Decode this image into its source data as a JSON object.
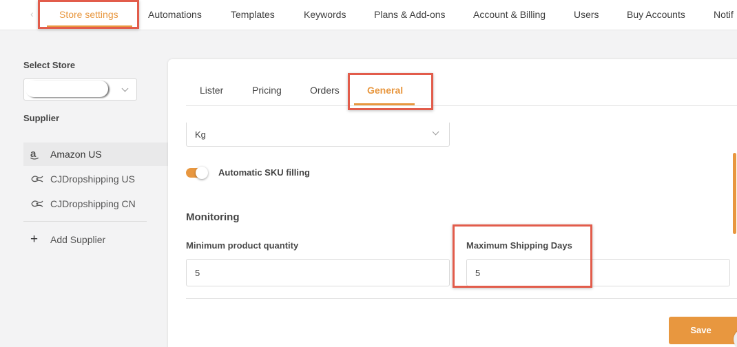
{
  "top_nav": {
    "back_arrow": "‹",
    "items": [
      {
        "label": "Store settings"
      },
      {
        "label": "Automations"
      },
      {
        "label": "Templates"
      },
      {
        "label": "Keywords"
      },
      {
        "label": "Plans & Add-ons"
      },
      {
        "label": "Account & Billing"
      },
      {
        "label": "Users"
      },
      {
        "label": "Buy Accounts"
      },
      {
        "label": "Notif"
      }
    ],
    "active_index": 0
  },
  "sidebar": {
    "select_store_label": "Select Store",
    "store_value": "",
    "supplier_label": "Supplier",
    "suppliers": [
      {
        "label": "Amazon US",
        "icon": "amazon-icon",
        "glyph": "a",
        "active": true
      },
      {
        "label": "CJDropshipping US",
        "icon": "cj-dropshipping-icon",
        "active": false
      },
      {
        "label": "CJDropshipping CN",
        "icon": "cj-dropshipping-icon",
        "active": false
      }
    ],
    "add_supplier_label": "Add Supplier",
    "add_icon": "+"
  },
  "sub_tabs": {
    "items": [
      {
        "label": "Lister"
      },
      {
        "label": "Pricing"
      },
      {
        "label": "Orders"
      },
      {
        "label": "General"
      }
    ],
    "active": "General"
  },
  "general": {
    "weight_unit": "Kg",
    "auto_sku": {
      "label": "Automatic SKU filling",
      "enabled": true
    },
    "monitoring": {
      "title": "Monitoring",
      "min_quantity": {
        "label": "Minimum product quantity",
        "value": "5"
      },
      "max_shipping_days": {
        "label": "Maximum Shipping Days",
        "value": "5"
      }
    },
    "save_label": "Save"
  },
  "colors": {
    "accent": "#e8973f",
    "highlight": "#e25c4b",
    "background": "#f3f3f4"
  }
}
